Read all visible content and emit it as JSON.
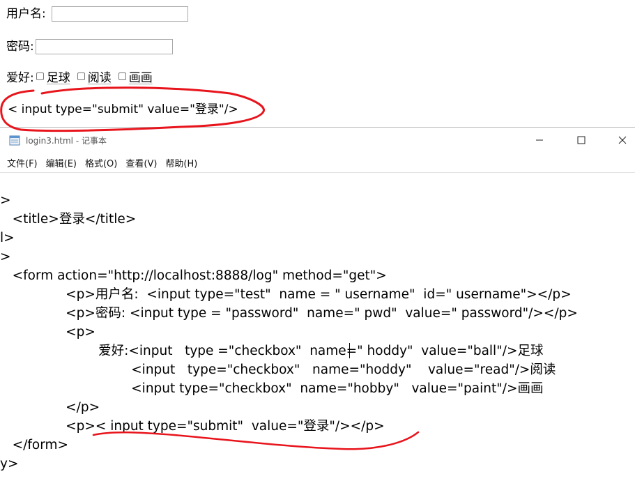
{
  "form": {
    "username_label": "用户名:",
    "password_label": "密码:",
    "hobby_label": "爱好:",
    "hobbies": [
      "足球",
      "阅读",
      "画画"
    ],
    "submit_text": "< input type=\"submit\" value=\"登录\"/>"
  },
  "notepad": {
    "title": "login3.html - 记事本",
    "window_buttons": {
      "minimize": "—",
      "maximize": "☐",
      "close": "✕"
    },
    "menu": [
      "文件(F)",
      "编辑(E)",
      "格式(O)",
      "查看(V)",
      "帮助(H)"
    ],
    "code_lines": [
      ">",
      "   <title>登录</title>",
      "l>",
      ">",
      "   <form action=\"http://localhost:8888/log\" method=\"get\">",
      "                <p>用户名:  <input type=\"test\"  name = \" username\"  id=\" username\"></p>",
      "                <p>密码: <input type = \"password\"  name=\" pwd\"  value=\" password\"/></p>",
      "                <p>",
      "                        爱好:<input   type =\"checkbox\"  name=\" hoddy\"  value=\"ball\"/>足球",
      "                                <input   type=\"checkbox\"   name=\"hoddy\"    value=\"read\"/>阅读",
      "                                <input type=\"checkbox\"  name=\"hobby\"   value=\"paint\"/>画画",
      "                </p>",
      "                <p>< input type=\"submit\"  value=\"登录\"/></p>",
      "   </form>",
      "y>"
    ]
  },
  "colors": {
    "annotation": "#e8141c",
    "window_bg": "#ffffff"
  },
  "icons": [
    "notepad-icon",
    "minimize-icon",
    "maximize-icon",
    "close-icon"
  ]
}
